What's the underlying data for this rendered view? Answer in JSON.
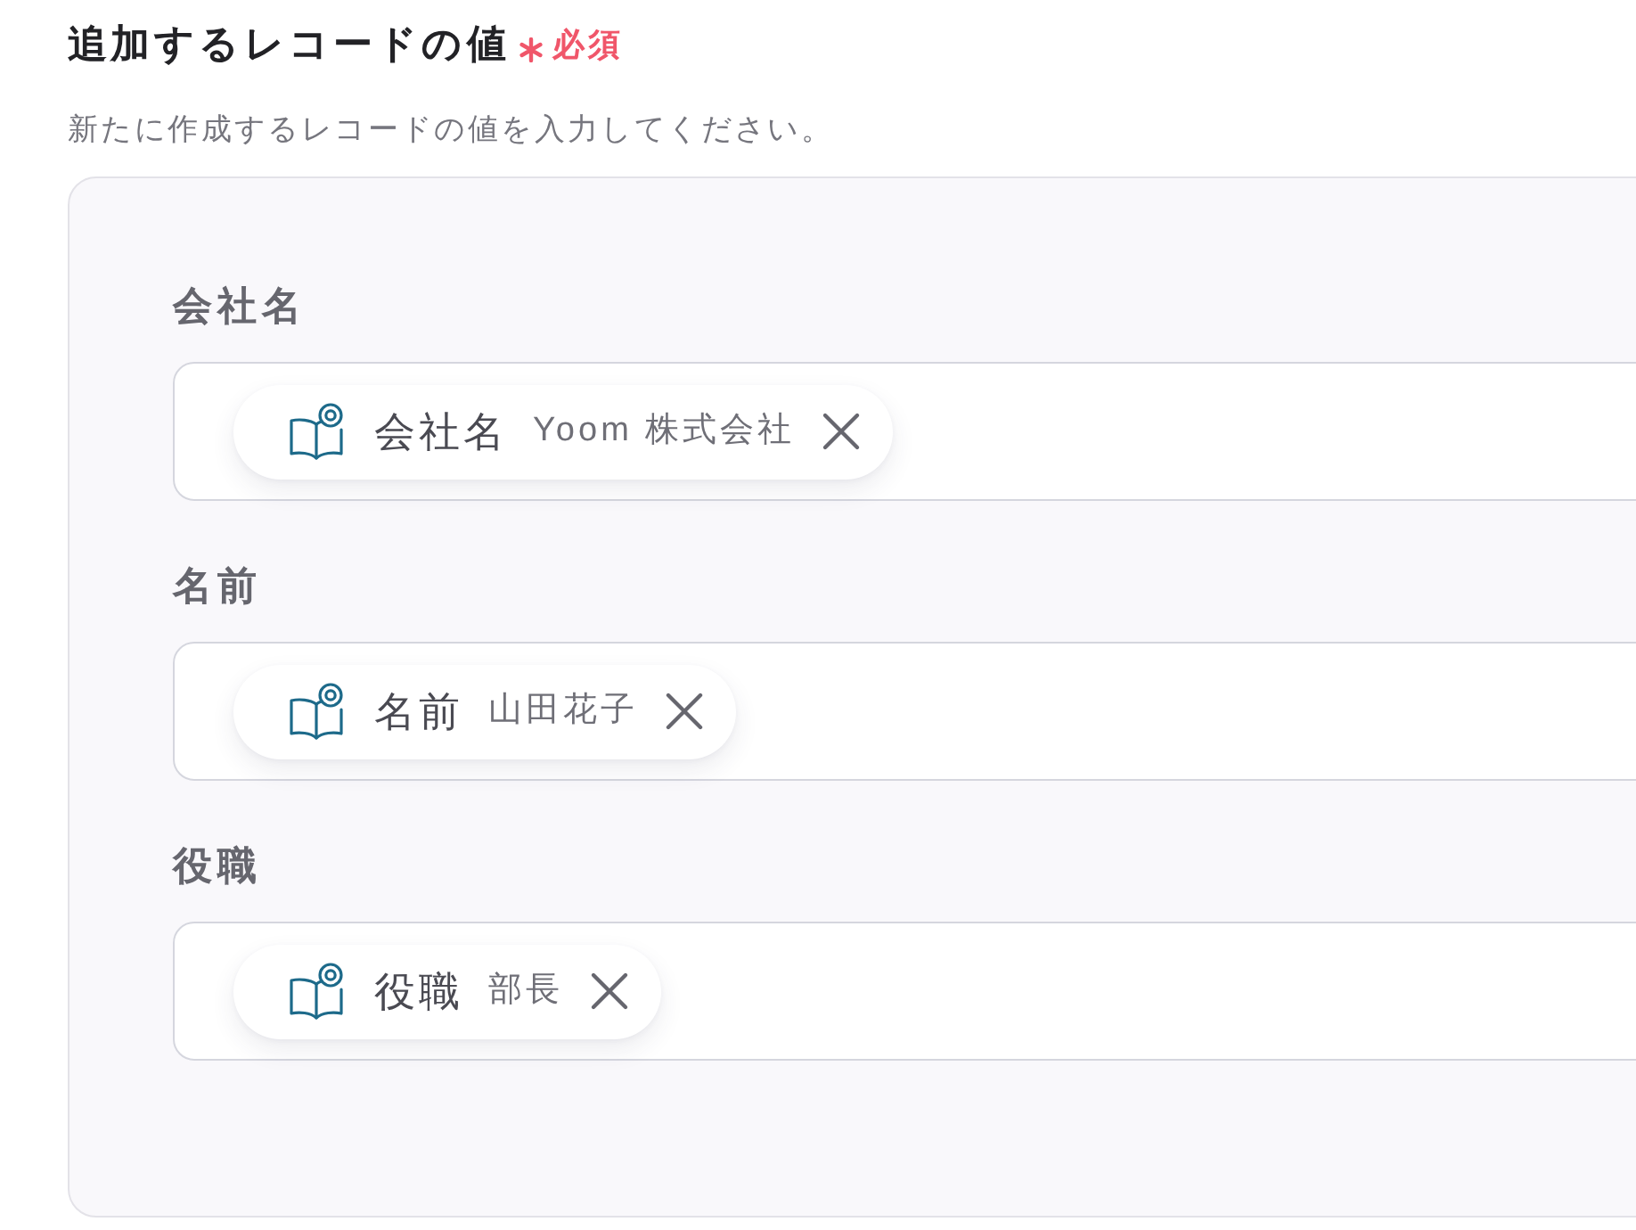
{
  "section": {
    "title": "追加するレコードの値",
    "required_label": "必須",
    "description": "新たに作成するレコードの値を入力してください。"
  },
  "fields": [
    {
      "label": "会社名",
      "token": {
        "name": "会社名",
        "value": "Yoom 株式会社"
      }
    },
    {
      "label": "名前",
      "token": {
        "name": "名前",
        "value": "山田花子"
      }
    },
    {
      "label": "役職",
      "token": {
        "name": "役職",
        "value": "部長"
      }
    }
  ]
}
